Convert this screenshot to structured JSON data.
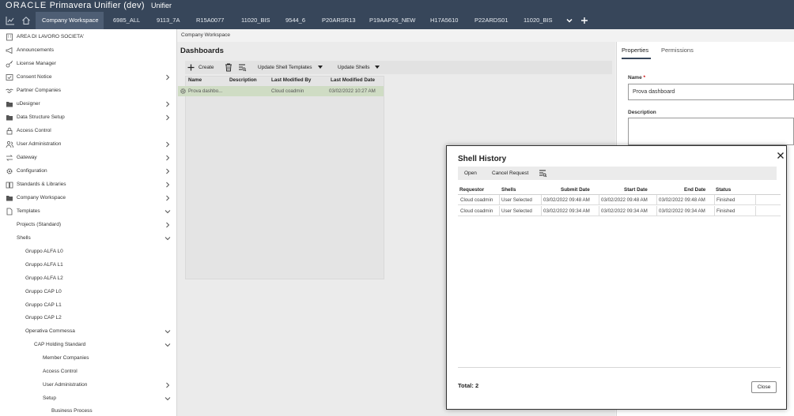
{
  "header": {
    "oracle": "ORACLE",
    "product": "Primavera Unifier (dev)",
    "env": "Unifier"
  },
  "tabs": [
    {
      "label": "Company Workspace"
    },
    {
      "label": "6985_ALL"
    },
    {
      "label": "9113_7A"
    },
    {
      "label": "R15A0077"
    },
    {
      "label": "11020_BIS"
    },
    {
      "label": "9544_6"
    },
    {
      "label": "P20ARSR13"
    },
    {
      "label": "P19AAP26_NEW"
    },
    {
      "label": "H17A5610"
    },
    {
      "label": "P22ARDS01"
    },
    {
      "label": "11020_BIS"
    }
  ],
  "sidebar": {
    "items": [
      {
        "label": "AREA DI LAVORO SOCIETA'",
        "icon": "building-icon"
      },
      {
        "label": "Announcements",
        "icon": "megaphone-icon"
      },
      {
        "label": "License Manager",
        "icon": "key-icon"
      },
      {
        "label": "Consent Notice",
        "icon": "consent-icon"
      },
      {
        "label": "Partner Companies",
        "icon": "handshake-icon"
      },
      {
        "label": "uDesigner",
        "icon": "folder-icon"
      },
      {
        "label": "Data Structure Setup",
        "icon": "folder-icon"
      },
      {
        "label": "Access Control",
        "icon": "lock-icon"
      },
      {
        "label": "User Administration",
        "icon": "users-icon"
      },
      {
        "label": "Gateway",
        "icon": "gateway-icon"
      },
      {
        "label": "Configuration",
        "icon": "gear-icon"
      },
      {
        "label": "Standards & Libraries",
        "icon": "book-icon"
      },
      {
        "label": "Company Workspace",
        "icon": "folder-icon"
      },
      {
        "label": "Templates",
        "icon": "document-icon"
      },
      {
        "label": "Projects (Standard)"
      },
      {
        "label": "Shells"
      },
      {
        "label": "Gruppo ALFA L0"
      },
      {
        "label": "Gruppo ALFA L1"
      },
      {
        "label": "Gruppo ALFA L2"
      },
      {
        "label": "Gruppo CAP L0"
      },
      {
        "label": "Gruppo CAP L1"
      },
      {
        "label": "Gruppo CAP L2"
      },
      {
        "label": "Operativa Commessa"
      },
      {
        "label": "CAP Holding Standard"
      },
      {
        "label": "Member Companies"
      },
      {
        "label": "Access Control"
      },
      {
        "label": "User Administration"
      },
      {
        "label": "Setup"
      },
      {
        "label": "Business Process"
      }
    ]
  },
  "main": {
    "breadcrumb": "Company Workspace",
    "title": "Dashboards",
    "toolbar": {
      "create": "Create",
      "update_templates": "Update Shell Templates",
      "update_shells": "Update Shells"
    },
    "columns": [
      "Name",
      "Description",
      "Last Modified By",
      "Last Modified Date"
    ],
    "rows": [
      {
        "name": "Prova dashbo...",
        "description": "",
        "modified_by": "Cloud coadmin",
        "modified_date": "03/02/2022 10:27 AM"
      }
    ]
  },
  "properties": {
    "tabs": [
      "Properties",
      "Permissions"
    ],
    "name_label": "Name",
    "required_mark": "*",
    "name_value": "Prova dashboard",
    "description_label": "Description"
  },
  "modal": {
    "title": "Shell History",
    "toolbar": {
      "open": "Open",
      "cancel_request": "Cancel Request"
    },
    "columns": [
      "Requestor",
      "Shells",
      "Submit Date",
      "Start Date",
      "End Date",
      "Status"
    ],
    "rows": [
      {
        "requestor": "Cloud coadmin",
        "shells": "User Selected",
        "submit": "03/02/2022 09:48 AM",
        "start": "03/02/2022 09:48 AM",
        "end": "03/02/2022 09:48 AM",
        "status": "Finished"
      },
      {
        "requestor": "Cloud coadmin",
        "shells": "User Selected",
        "submit": "03/02/2022 09:34 AM",
        "start": "03/02/2022 09:34 AM",
        "end": "03/02/2022 09:34 AM",
        "status": "Finished"
      }
    ],
    "total": "Total: 2",
    "close_label": "Close"
  },
  "colors": {
    "header_bg": "#37465a",
    "active_tab": "#4e5e74",
    "selected_row": "#cfdcc4"
  }
}
